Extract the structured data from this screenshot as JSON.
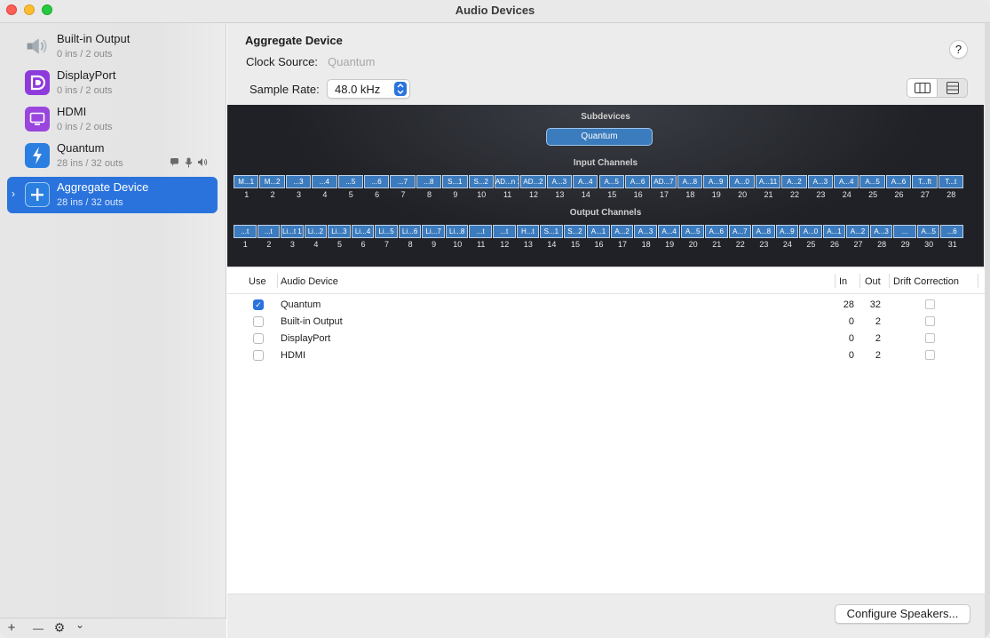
{
  "window": {
    "title": "Audio Devices"
  },
  "sidebar": {
    "items": [
      {
        "name": "Built-in Output",
        "sub": "0 ins / 2 outs",
        "icon": "speaker-icon",
        "color": "#9aa4ad"
      },
      {
        "name": "DisplayPort",
        "sub": "0 ins / 2 outs",
        "icon": "displayport-icon",
        "color": "#8e3bdc"
      },
      {
        "name": "HDMI",
        "sub": "0 ins / 2 outs",
        "icon": "display-icon",
        "color": "#9a46de"
      },
      {
        "name": "Quantum",
        "sub": "28 ins / 32 outs",
        "icon": "thunderbolt-icon",
        "color": "#2a7fe0"
      },
      {
        "name": "Aggregate Device",
        "sub": "28 ins / 32 outs",
        "icon": "plus-icon",
        "color": "#2a7fe0"
      }
    ],
    "footer": {
      "add": "+",
      "remove": "—",
      "gear": "⚙",
      "chevron": "⌄"
    }
  },
  "main": {
    "device_title": "Aggregate Device",
    "clock_label": "Clock Source:",
    "clock_value": "Quantum",
    "rate_label": "Sample Rate:",
    "rate_value": "48.0 kHz",
    "help": "?",
    "subdevices_label": "Subdevices",
    "subdevice_button": "Quantum",
    "input_label": "Input Channels",
    "output_label": "Output Channels",
    "input_channels": [
      "M...1",
      "M...2",
      "...3",
      "...4",
      "...5",
      "...6",
      "...7",
      "...8",
      "S...1",
      "S...2",
      "AD...n 1",
      "AD...2",
      "A...3",
      "A...4",
      "A...5",
      "A...6",
      "AD...7",
      "A...8",
      "A...9",
      "A...0",
      "A...11",
      "A...2",
      "A...3",
      "A...4",
      "A...5",
      "A...6",
      "T...ft",
      "T...t"
    ],
    "output_channels": [
      "...t",
      "...t",
      "Li...t 1",
      "Li...2",
      "Li...3",
      "Li...4",
      "Li...5",
      "Li...6",
      "Li...7",
      "Li...8",
      "...t",
      "...t",
      "H...t",
      "S...1",
      "S...2",
      "A...1",
      "A...2",
      "A...3",
      "A...4",
      "A...5",
      "A...6",
      "A...7",
      "A...8",
      "A...9",
      "A...0",
      "A...1",
      "A...2",
      "A...3",
      "...",
      "A...5",
      "...6"
    ],
    "table": {
      "headers": {
        "use": "Use",
        "device": "Audio Device",
        "in": "In",
        "out": "Out",
        "drift": "Drift Correction"
      },
      "rows": [
        {
          "name": "Quantum",
          "in": "28",
          "out": "32",
          "used": true
        },
        {
          "name": "Built-in Output",
          "in": "0",
          "out": "2",
          "used": false
        },
        {
          "name": "DisplayPort",
          "in": "0",
          "out": "2",
          "used": false
        },
        {
          "name": "HDMI",
          "in": "0",
          "out": "2",
          "used": false
        }
      ]
    },
    "configure_button": "Configure Speakers..."
  }
}
